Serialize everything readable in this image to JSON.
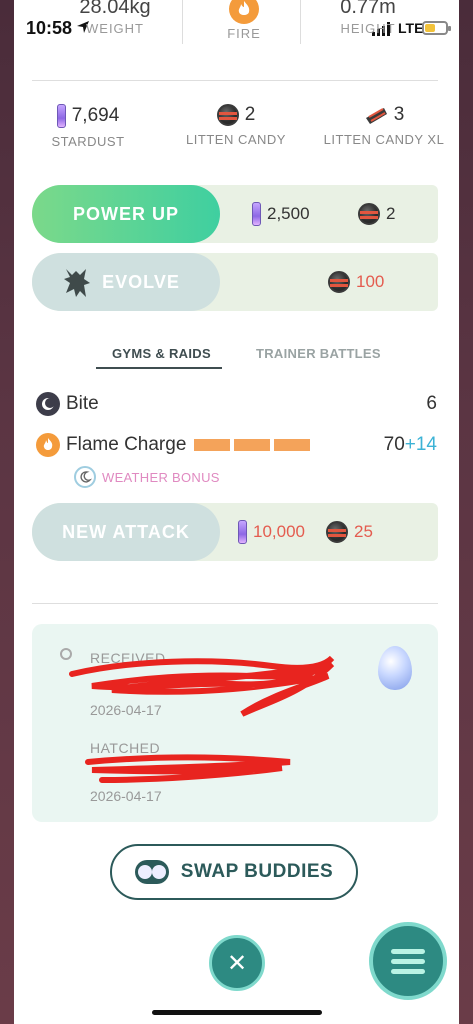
{
  "status_bar": {
    "time": "10:58",
    "network": "LTE"
  },
  "top_stats": {
    "weight_value": "28.04kg",
    "weight_label": "WEIGHT",
    "type_label": "FIRE",
    "height_value": "0.77m",
    "height_label": "HEIGHT"
  },
  "resources": {
    "stardust": {
      "value": "7,694",
      "label": "STARDUST"
    },
    "candy": {
      "value": "2",
      "label": "LITTEN CANDY"
    },
    "candy_xl": {
      "value": "3",
      "label": "LITTEN CANDY XL"
    }
  },
  "power_up": {
    "label": "POWER UP",
    "stardust_cost": "2,500",
    "candy_cost": "2"
  },
  "evolve": {
    "label": "EVOLVE",
    "candy_cost": "100"
  },
  "tabs": {
    "active": "GYMS & RAIDS",
    "inactive": "TRAINER BATTLES"
  },
  "moves": {
    "fast": {
      "name": "Bite",
      "value": "6"
    },
    "charged": {
      "name": "Flame Charge",
      "value": "70",
      "bonus": "+14",
      "energy_bars": 3
    },
    "weather_bonus": "WEATHER BONUS"
  },
  "new_attack": {
    "label": "NEW ATTACK",
    "stardust_cost": "10,000",
    "candy_cost": "25"
  },
  "info": {
    "received_label": "RECEIVED",
    "received_date": "2026-04-17",
    "hatched_label": "HATCHED",
    "hatched_date": "2026-04-17"
  },
  "swap_buddies": {
    "label": "SWAP BUDDIES"
  },
  "close_glyph": "✕",
  "colors": {
    "power_up_green": "#3fcfa0",
    "fire": "#f49b3b",
    "cost_red": "#e45c4f",
    "bonus_blue": "#3cb3d6",
    "weather_pink": "#e08ac1",
    "menu_teal": "#2d8a82"
  }
}
